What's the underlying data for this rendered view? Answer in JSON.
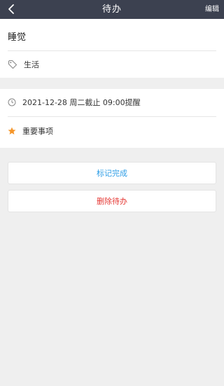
{
  "header": {
    "title": "待办",
    "edit_label": "编辑",
    "back_icon": "chevron-left-icon"
  },
  "task": {
    "title": "睡觉",
    "tag_icon": "tag-icon",
    "tag": "生活"
  },
  "schedule": {
    "clock_icon": "clock-icon",
    "deadline_text": "2021-12-28 周二截止 09:00提醒",
    "importance_icon": "star-icon",
    "importance_label": "重要事项",
    "importance_color": "#f5962a"
  },
  "actions": {
    "complete_label": "标记完成",
    "complete_color": "#2f9ee6",
    "delete_label": "删除待办",
    "delete_color": "#e53935"
  },
  "colors": {
    "header_bg": "#3c4150",
    "page_bg": "#efefef"
  }
}
